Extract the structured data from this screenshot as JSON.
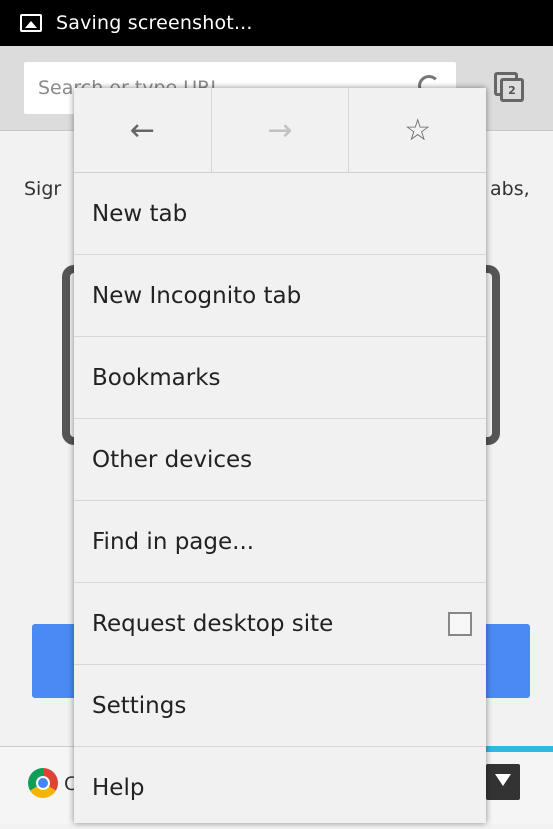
{
  "status_bar": {
    "text": "Saving screenshot...",
    "icon": "image-icon"
  },
  "toolbar": {
    "omnibox_placeholder": "Search or type URL",
    "tab_count": "2"
  },
  "background": {
    "left_text": "Sigr",
    "right_text": "abs,",
    "bottom_text": "C"
  },
  "menu": {
    "nav": {
      "back_icon": "←",
      "forward_icon": "→",
      "bookmark_icon": "☆"
    },
    "items": [
      {
        "label": "New tab"
      },
      {
        "label": "New Incognito tab"
      },
      {
        "label": "Bookmarks"
      },
      {
        "label": "Other devices"
      },
      {
        "label": "Find in page..."
      },
      {
        "label": "Request desktop site",
        "checkbox": false
      },
      {
        "label": "Settings"
      },
      {
        "label": "Help"
      }
    ]
  },
  "colors": {
    "accent_blue": "#4a8af4",
    "holo_blue": "#33b5e5"
  }
}
